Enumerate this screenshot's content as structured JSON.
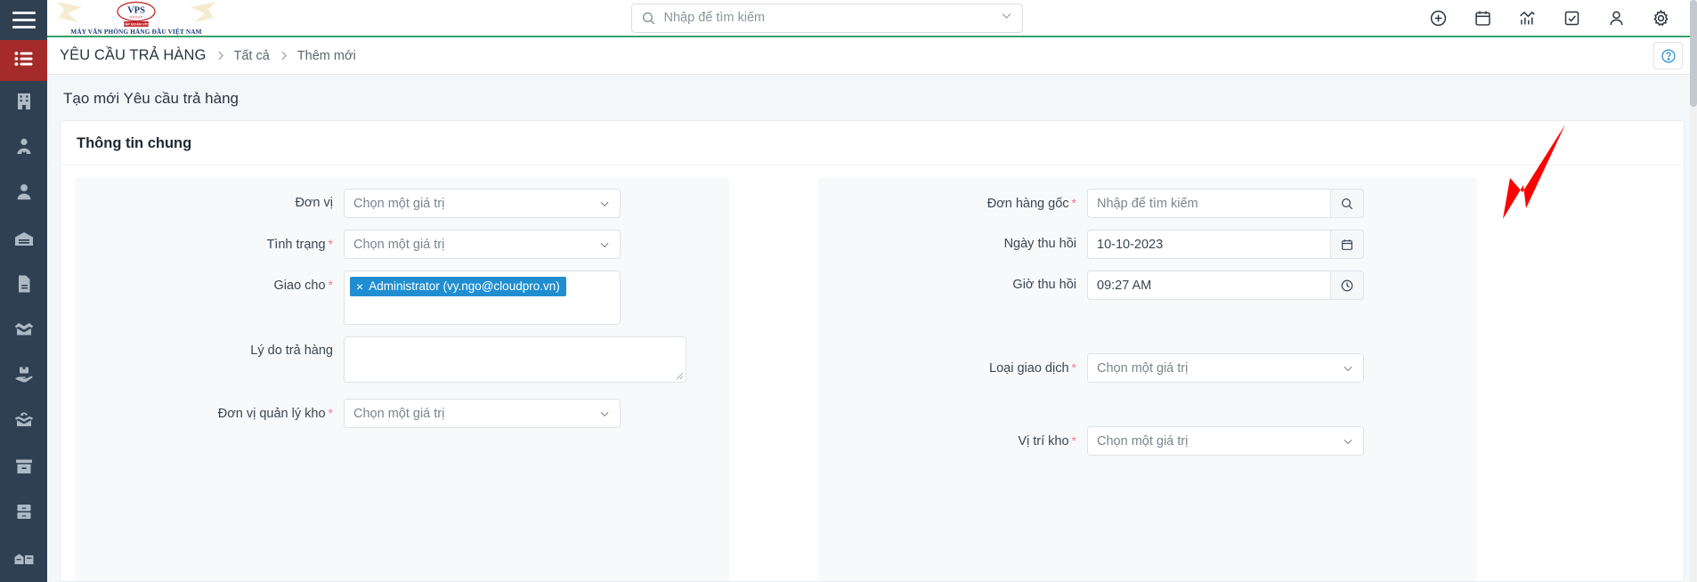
{
  "brand": {
    "logo_text": "VPS",
    "logo_sub": "GROUP",
    "logo_badge": "TẬP ĐOÀN VPS",
    "tagline": "MÁY VĂN PHÒNG HÀNG ĐẦU VIỆT NAM"
  },
  "header": {
    "search_placeholder": "Nhập để tìm kiếm",
    "search_value": "",
    "icons": [
      {
        "name": "add-circle-icon",
        "label": "Tạo mới"
      },
      {
        "name": "calendar-icon",
        "label": "Lịch"
      },
      {
        "name": "chart-icon",
        "label": "Báo cáo"
      },
      {
        "name": "checkbox-icon",
        "label": "Công việc"
      },
      {
        "name": "user-icon",
        "label": "Tài khoản"
      },
      {
        "name": "gear-icon",
        "label": "Cài đặt"
      }
    ]
  },
  "breadcrumb": {
    "module": "YÊU CẦU TRẢ HÀNG",
    "items": [
      {
        "label": "Tất cả"
      },
      {
        "label": "Thêm mới"
      }
    ],
    "help_label": "?"
  },
  "page": {
    "title": "Tạo mới Yêu cầu trả hàng",
    "section_title": "Thông tin chung"
  },
  "sidebar": {
    "items": [
      {
        "name": "hamburger-menu",
        "label": "Menu"
      },
      {
        "name": "list-icon",
        "label": "Danh sách",
        "active": true
      },
      {
        "name": "building-icon",
        "label": "Công ty"
      },
      {
        "name": "contact-icon",
        "label": "Liên hệ"
      },
      {
        "name": "user-icon",
        "label": "Người dùng"
      },
      {
        "name": "warehouse-icon",
        "label": "Kho"
      },
      {
        "name": "document-icon",
        "label": "Tài liệu"
      },
      {
        "name": "open-box-icon",
        "label": "Sản phẩm"
      },
      {
        "name": "box-hand-icon",
        "label": "Giao hàng"
      },
      {
        "name": "return-box-icon",
        "label": "Trả hàng"
      },
      {
        "name": "archive-box-icon",
        "label": "Lưu trữ"
      },
      {
        "name": "file-cabinet-icon",
        "label": "Hồ sơ"
      },
      {
        "name": "warehouse-truck-icon",
        "label": "Vận chuyển"
      }
    ]
  },
  "form": {
    "placeholder_select": "Chọn một giá trị",
    "placeholder_search": "Nhập để tìm kiếm",
    "left": [
      {
        "name": "don-vi",
        "label": "Đơn vị",
        "required": false,
        "type": "select",
        "value": ""
      },
      {
        "name": "tinh-trang",
        "label": "Tình trạng",
        "required": true,
        "type": "select",
        "value": ""
      },
      {
        "name": "giao-cho",
        "label": "Giao cho",
        "required": true,
        "type": "tags",
        "value": "Administrator (vy.ngo@cloudpro.vn)"
      },
      {
        "name": "ly-do-tra-hang",
        "label": "Lý do trả hàng",
        "required": false,
        "type": "textarea",
        "value": ""
      },
      {
        "name": "don-vi-quan-ly-kho",
        "label": "Đơn vị quản lý kho",
        "required": true,
        "type": "select",
        "value": ""
      }
    ],
    "right": [
      {
        "name": "don-hang-goc",
        "label": "Đơn hàng gốc",
        "required": true,
        "type": "search-input",
        "value": ""
      },
      {
        "name": "ngay-thu-hoi",
        "label": "Ngày thu hồi",
        "required": false,
        "type": "date",
        "value": "10-10-2023"
      },
      {
        "name": "gio-thu-hoi",
        "label": "Giờ thu hồi",
        "required": false,
        "type": "time",
        "value": "09:27 AM"
      },
      {
        "name": "loai-giao-dich",
        "label": "Loại giao dịch",
        "required": true,
        "type": "select",
        "value": ""
      },
      {
        "name": "vi-tri-kho",
        "label": "Vị trí kho",
        "required": true,
        "type": "select",
        "value": ""
      }
    ]
  },
  "colors": {
    "sidebar_bg": "#2e4052",
    "sidebar_active": "#a52a2a",
    "accent_green": "#37a06b",
    "chip_blue": "#1f8ed1",
    "required_red": "#ef7b88",
    "annotation_red": "#ff0000",
    "body_bg": "#f4f7f9"
  }
}
